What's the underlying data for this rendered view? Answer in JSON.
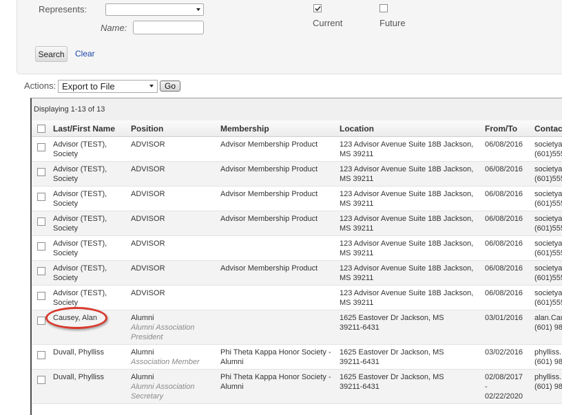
{
  "search": {
    "represents_label": "Represents:",
    "represents_value": "",
    "name_label": "Name:",
    "name_value": "",
    "current_label": "Current",
    "current_checked": true,
    "future_label": "Future",
    "future_checked": false,
    "search_button": "Search",
    "clear_link": "Clear"
  },
  "actions": {
    "label": "Actions:",
    "selected": "Export to File",
    "go_button": "Go"
  },
  "grid": {
    "caption": "Displaying 1-13 of 13",
    "columns": [
      "Last/First Name",
      "Position",
      "Membership",
      "Location",
      "From/To",
      "Contac"
    ],
    "rows": [
      {
        "name1": "Advisor (TEST),",
        "name2": "Society",
        "position": "ADVISOR",
        "position_sub": "",
        "position_sub2": "",
        "membership1": "Advisor Membership Product",
        "membership2": "",
        "location1": "123 Advisor Avenue Suite 18B Jackson,",
        "location2": "MS 39211",
        "from": "06/08/2016",
        "dash": "",
        "to": "",
        "contact1": "societya",
        "contact2": "(601)555"
      },
      {
        "name1": "Advisor (TEST),",
        "name2": "Society",
        "position": "ADVISOR",
        "position_sub": "",
        "position_sub2": "",
        "membership1": "Advisor Membership Product",
        "membership2": "",
        "location1": "123 Advisor Avenue Suite 18B Jackson,",
        "location2": "MS 39211",
        "from": "06/08/2016",
        "dash": "",
        "to": "",
        "contact1": "societya",
        "contact2": "(601)555"
      },
      {
        "name1": "Advisor (TEST),",
        "name2": "Society",
        "position": "ADVISOR",
        "position_sub": "",
        "position_sub2": "",
        "membership1": "Advisor Membership Product",
        "membership2": "",
        "location1": "123 Advisor Avenue Suite 18B Jackson,",
        "location2": "MS 39211",
        "from": "06/08/2016",
        "dash": "",
        "to": "",
        "contact1": "societya",
        "contact2": "(601)555"
      },
      {
        "name1": "Advisor (TEST),",
        "name2": "Society",
        "position": "ADVISOR",
        "position_sub": "",
        "position_sub2": "",
        "membership1": "Advisor Membership Product",
        "membership2": "",
        "location1": "123 Advisor Avenue Suite 18B Jackson,",
        "location2": "MS 39211",
        "from": "06/08/2016",
        "dash": "",
        "to": "",
        "contact1": "societya",
        "contact2": "(601)555"
      },
      {
        "name1": "Advisor (TEST),",
        "name2": "Society",
        "position": "ADVISOR",
        "position_sub": "",
        "position_sub2": "",
        "membership1": "",
        "membership2": "",
        "location1": "123 Advisor Avenue Suite 18B Jackson,",
        "location2": "MS 39211",
        "from": "06/08/2016",
        "dash": "",
        "to": "",
        "contact1": "societya",
        "contact2": "(601)555"
      },
      {
        "name1": "Advisor (TEST),",
        "name2": "Society",
        "position": "ADVISOR",
        "position_sub": "",
        "position_sub2": "",
        "membership1": "Advisor Membership Product",
        "membership2": "",
        "location1": "123 Advisor Avenue Suite 18B Jackson,",
        "location2": "MS 39211",
        "from": "06/08/2016",
        "dash": "",
        "to": "",
        "contact1": "societya",
        "contact2": "(601)555"
      },
      {
        "name1": "Advisor (TEST),",
        "name2": "Society",
        "position": "ADVISOR",
        "position_sub": "",
        "position_sub2": "",
        "membership1": "",
        "membership2": "",
        "location1": "123 Advisor Avenue Suite 18B Jackson,",
        "location2": "MS 39211",
        "from": "06/08/2016",
        "dash": "",
        "to": "",
        "contact1": "societya",
        "contact2": "(601)555"
      },
      {
        "name1": "Causey, Alan",
        "name2": "",
        "position": "Alumni",
        "position_sub": "Alumni Association",
        "position_sub2": "President",
        "membership1": "",
        "membership2": "",
        "location1": "1625 Eastover Dr Jackson, MS",
        "location2": "39211-6431",
        "from": "03/01/2016",
        "dash": "",
        "to": "",
        "contact1": "alan.Cau",
        "contact2": "(601) 98"
      },
      {
        "name1": "Duvall, Phylliss",
        "name2": "",
        "position": "Alumni",
        "position_sub": "Association Member",
        "position_sub2": "",
        "membership1": "Phi Theta Kappa Honor Society -",
        "membership2": "Alumni",
        "location1": "1625 Eastover Dr Jackson, MS",
        "location2": "39211-6431",
        "from": "03/02/2016",
        "dash": "",
        "to": "",
        "contact1": "phylliss.",
        "contact2": "(601) 98"
      },
      {
        "name1": "Duvall, Phylliss",
        "name2": "",
        "position": "Alumni",
        "position_sub": "Alumni Association",
        "position_sub2": "Secretary",
        "membership1": "Phi Theta Kappa Honor Society -",
        "membership2": "Alumni",
        "location1": "1625 Eastover Dr Jackson, MS",
        "location2": "39211-6431",
        "from": "02/08/2017",
        "dash": "-",
        "to": "02/22/2020",
        "contact1": "phylliss.",
        "contact2": "(601) 98"
      }
    ]
  }
}
